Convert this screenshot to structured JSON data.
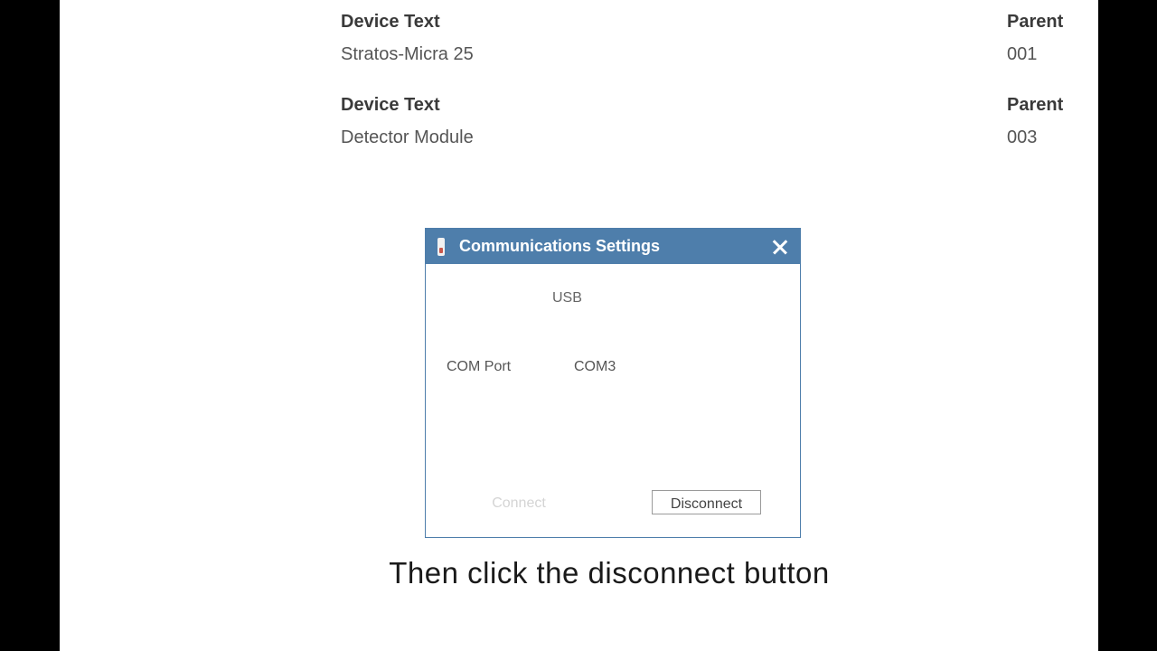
{
  "devices": [
    {
      "label": "Device Text",
      "value": "Stratos-Micra 25",
      "parent_label": "Parent",
      "parent_value": "001"
    },
    {
      "label": "Device Text",
      "value": "Detector Module",
      "parent_label": "Parent",
      "parent_value": "003"
    }
  ],
  "dialog": {
    "title": "Communications Settings",
    "title_icon": "app-device-icon",
    "close_icon": "close-icon",
    "connection_type": "USB",
    "com_port_label": "COM Port",
    "com_port_value": "COM3",
    "connect_label": "Connect",
    "disconnect_label": "Disconnect"
  },
  "caption": "Then click the disconnect button",
  "colors": {
    "titlebar": "#4e7eab",
    "background": "#ffffff",
    "letterbox": "#000000"
  }
}
